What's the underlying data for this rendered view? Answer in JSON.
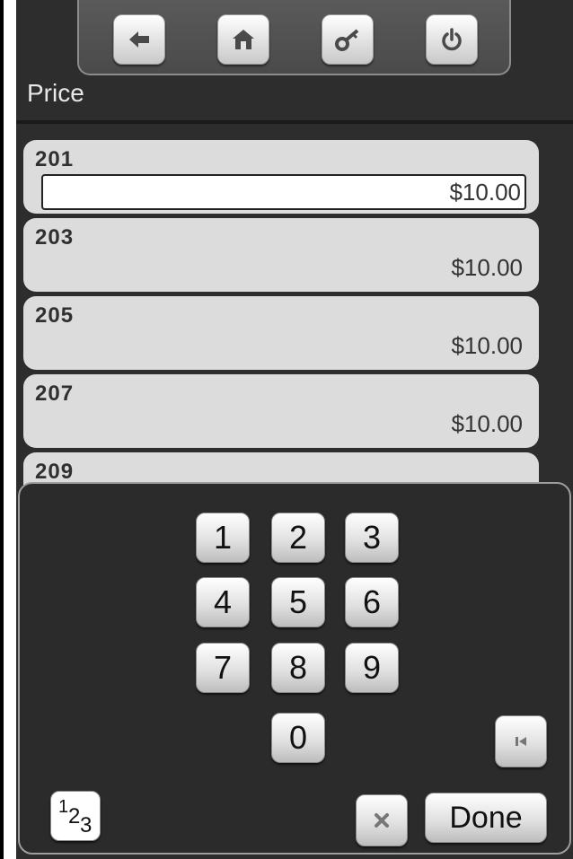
{
  "nav": {
    "buttons": [
      "back-arrow-icon",
      "home-icon",
      "key-icon",
      "power-icon"
    ]
  },
  "page": {
    "title": "Price"
  },
  "list": {
    "items": [
      {
        "label": "201",
        "value": "$10.00"
      },
      {
        "label": "203",
        "value": "$10.00"
      },
      {
        "label": "205",
        "value": "$10.00"
      },
      {
        "label": "207",
        "value": "$10.00"
      },
      {
        "label": "209",
        "value": ""
      }
    ]
  },
  "keypad": {
    "digits": [
      "1",
      "2",
      "3",
      "4",
      "5",
      "6",
      "7",
      "8",
      "9",
      "0"
    ],
    "mode_parts": [
      "1",
      "2",
      "3"
    ],
    "done_label": "Done",
    "icons": [
      "skip-to-start-icon",
      "clear-x-icon"
    ]
  },
  "colors": {
    "background": "#2d2d2d",
    "list_item": "#dcdcdc",
    "key": "#ffffff"
  }
}
